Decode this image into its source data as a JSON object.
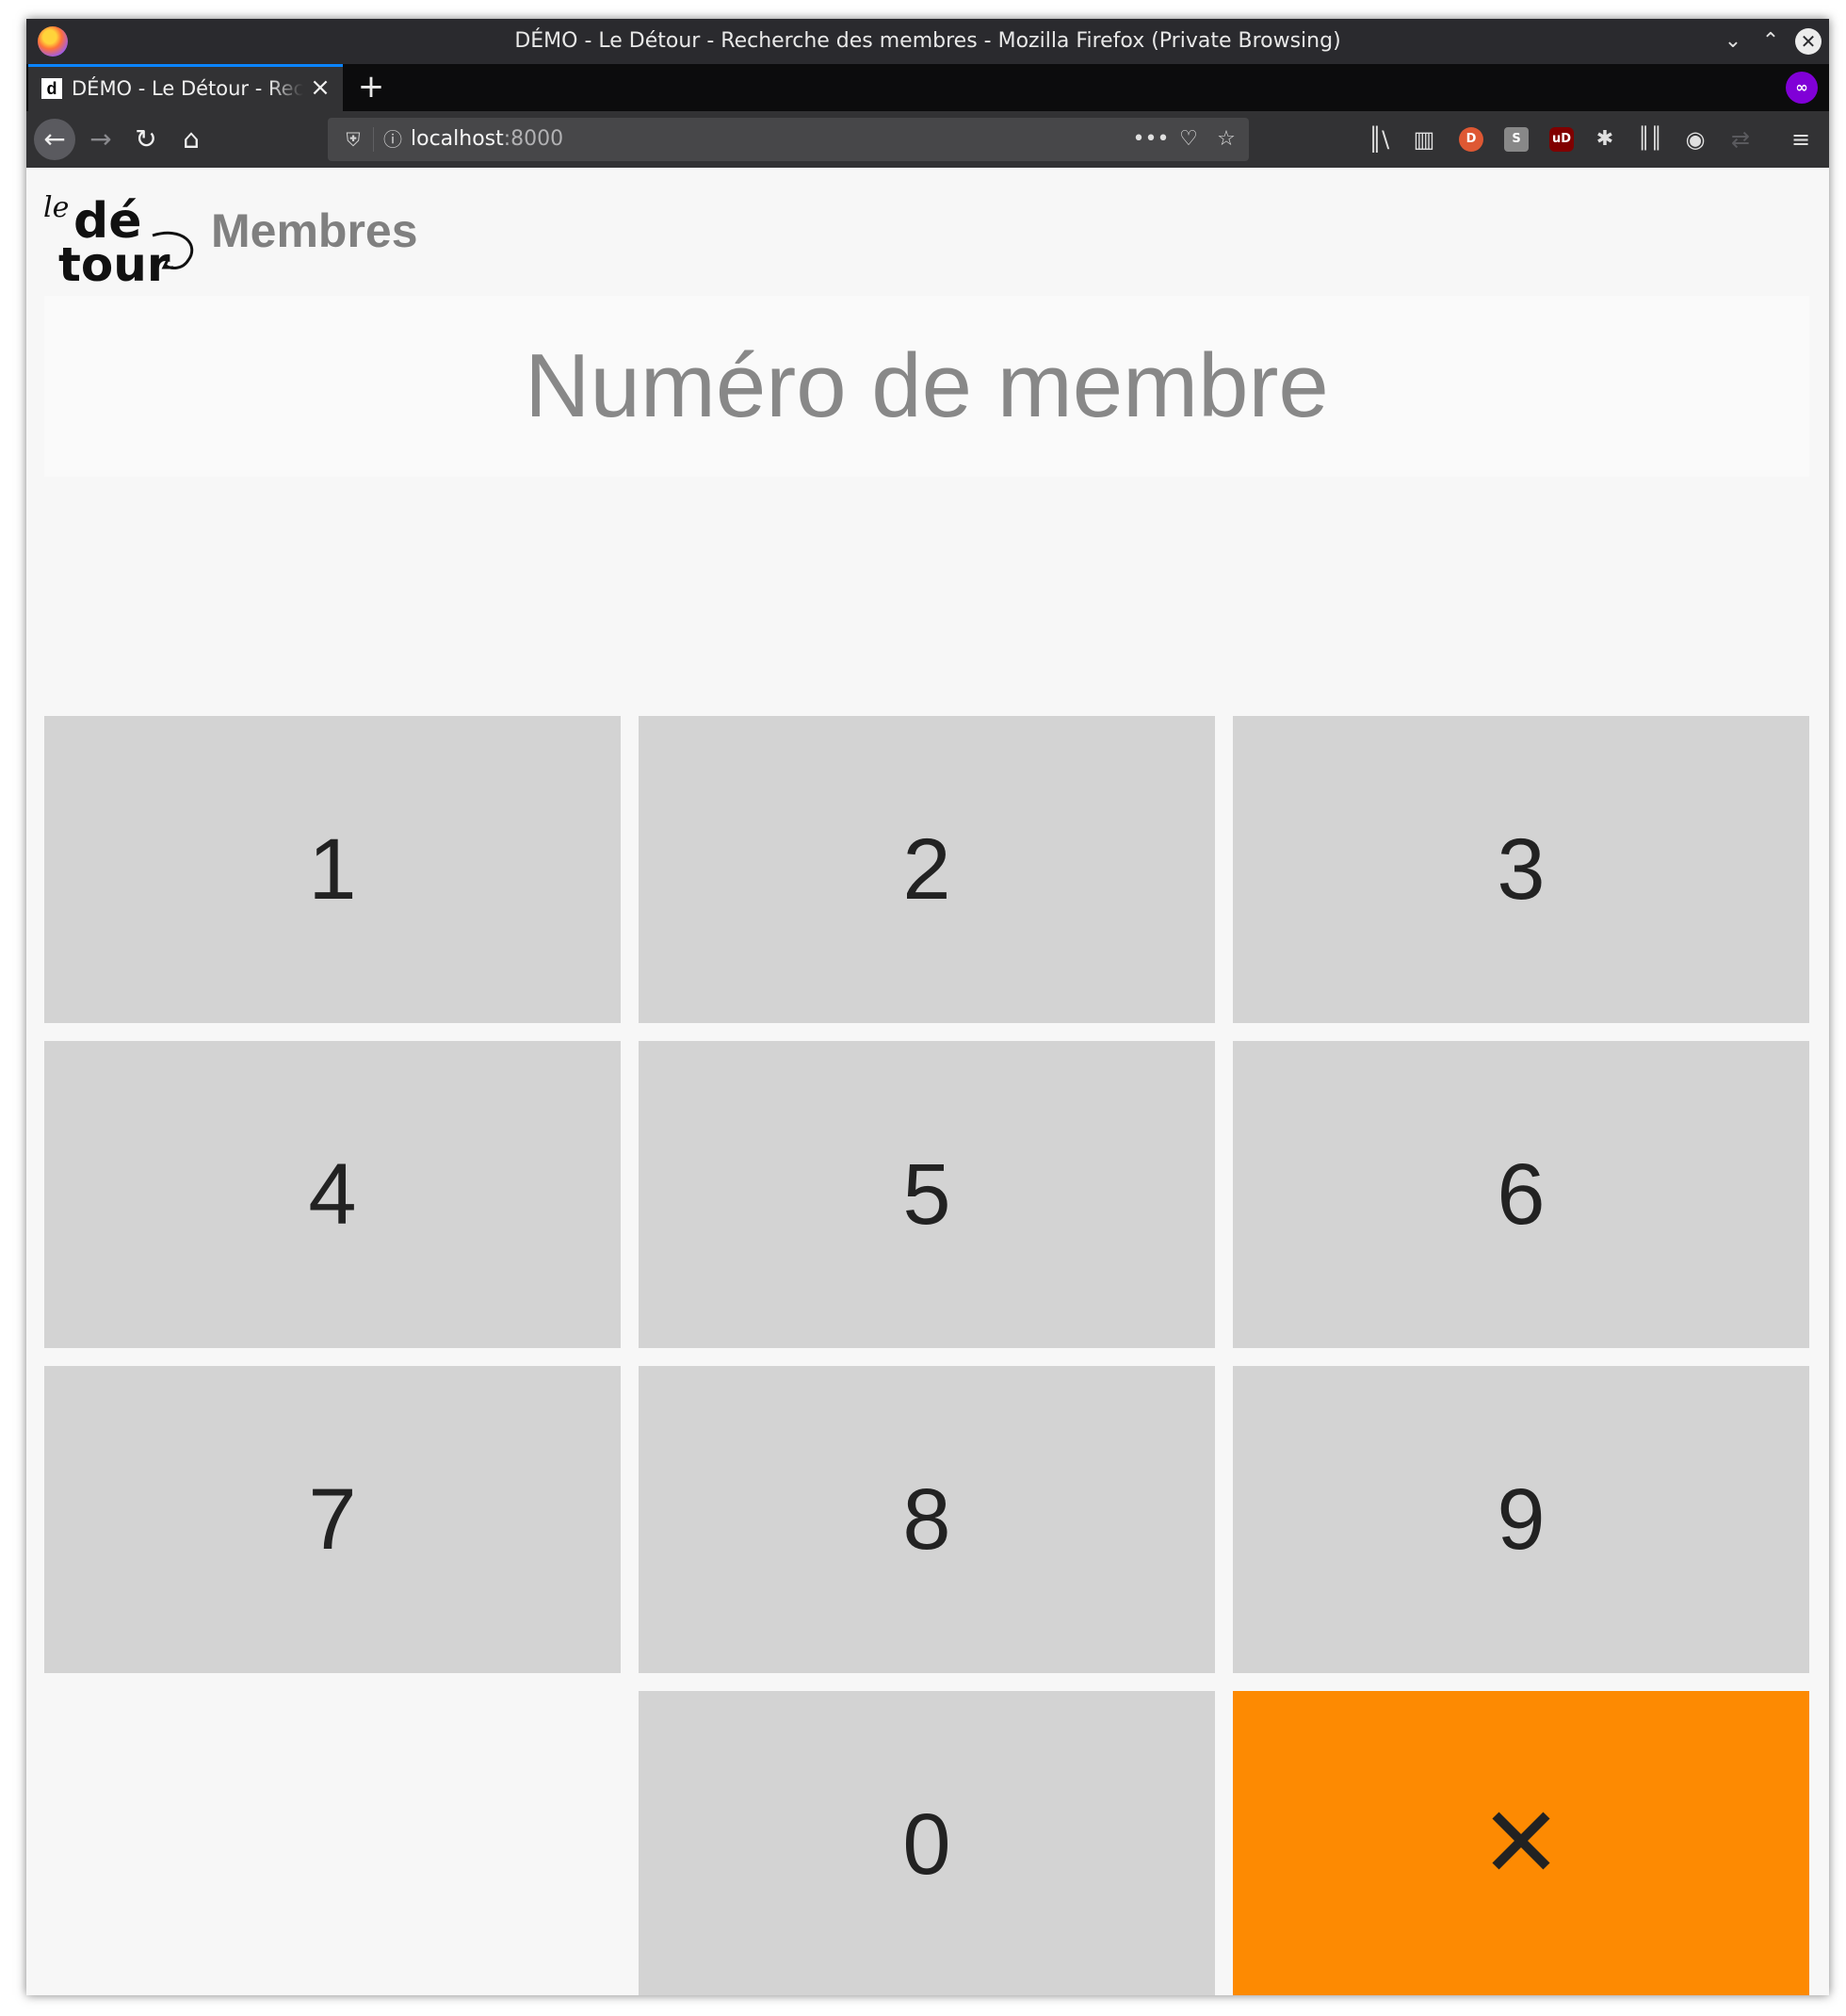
{
  "window": {
    "title": "DÉMO - Le Détour - Recherche des membres - Mozilla Firefox (Private Browsing)"
  },
  "tabs": [
    {
      "label": "DÉMO - Le Détour - Recherche des membres",
      "favicon": "d"
    }
  ],
  "toolbar": {
    "url_host": "localhost",
    "url_port": ":8000"
  },
  "page": {
    "logo_text": [
      "le",
      "dé",
      "tour"
    ],
    "title": "Membres",
    "member_input": {
      "placeholder": "Numéro de membre",
      "value": ""
    },
    "keypad": {
      "keys": [
        "1",
        "2",
        "3",
        "4",
        "5",
        "6",
        "7",
        "8",
        "9",
        "",
        "0",
        "×"
      ],
      "clear_color": "#fd8a02",
      "key_color": "#d3d3d3"
    }
  },
  "icons": [
    "firefox-icon",
    "chevron-down-icon",
    "chevron-up-icon",
    "close-icon",
    "plus-icon",
    "private-browsing-icon",
    "back-arrow-icon",
    "forward-arrow-icon",
    "reload-icon",
    "home-icon",
    "shield-icon",
    "info-icon",
    "more-icon",
    "pocket-icon",
    "star-icon",
    "library-icon",
    "sidebar-icon",
    "duckduckgo-icon",
    "extension-icon",
    "ublock-icon",
    "privacy-badger-icon",
    "extension-bars-icon",
    "account-icon",
    "sync-icon",
    "hamburger-menu-icon"
  ]
}
